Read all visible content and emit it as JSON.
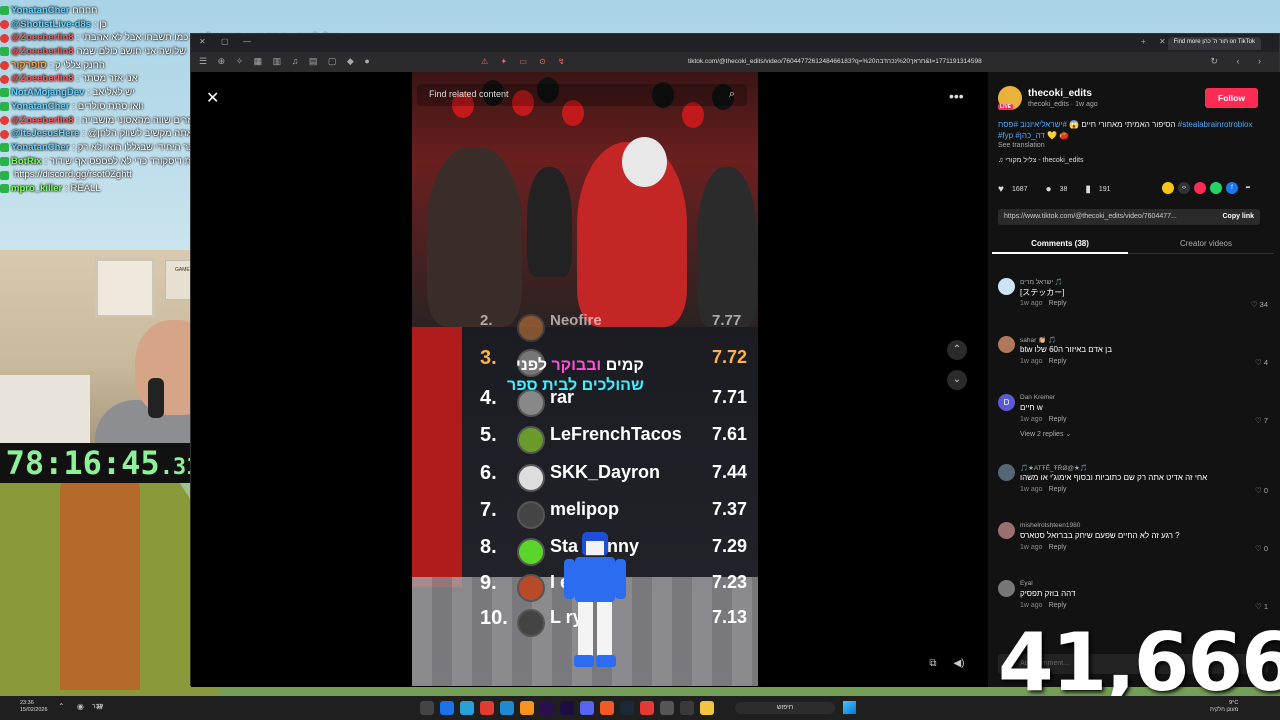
{
  "chat": [
    {
      "user": "YonatanCher",
      "msg": "חחחח",
      "color": "#6ad3ff",
      "badge": "g"
    },
    {
      "user": "@ShotistLive-d8s",
      "msg": ": כן",
      "color": "#6ad3ff",
      "badge": "r"
    },
    {
      "user": "@Zoeeberlin8",
      "msg": ": איך באלי להגיד את מה שאני חושב על ה... כמו תשבחו אבל לא אהבתי",
      "color": "#ff5a5a",
      "badge": "r"
    },
    {
      "user": "@Zoeeberlin8",
      "msg": "שלושה אני חושב כולם שמה",
      "color": "#ff5a5a",
      "badge": "g"
    },
    {
      "user": "סופרקור",
      "msg": ": החנק צללי ק",
      "color": "#ff9a3c",
      "badge": "r"
    },
    {
      "user": "@Zoeeberlin8",
      "msg": ": אני אזר מסתר",
      "color": "#ff5a5a",
      "badge": "r"
    },
    {
      "user": "NotAMojangDev",
      "msg": ": יש לאליאב",
      "color": "#6ad3ff",
      "badge": "g"
    },
    {
      "user": "YonatanCher",
      "msg": ": וואו סתת סולדים",
      "color": "#6ad3ff",
      "badge": "g"
    },
    {
      "user": "@Zoeeberlin8",
      "msg": ": יש האומרים שווה מהאסוני מושבייה",
      "color": "#ff5a5a",
      "badge": "r"
    },
    {
      "user": "@ItsJesusHere",
      "msg": ": @שוטיסט תגיד שו אתה מקשיב לשווק הלחן?",
      "color": "#6ad3ff",
      "badge": "r"
    },
    {
      "user": "YonatanCher",
      "msg": ": זה הדבר היחידי שבגללו הוא ולא רק",
      "color": "#6ad3ff",
      "badge": "g"
    },
    {
      "user": "BotRix",
      "msg": ": אם אתם נהנים מהשידורים כנסו לשרת דיסקורד כדי לא לפספס אף שידור",
      "color": "#7cff5a",
      "badge": "g"
    },
    {
      "user": "",
      "msg": "https://discord.gg/rsot0Zghtt",
      "color": "#ffffff",
      "badge": "g"
    },
    {
      "user": "mpro_killer",
      "msg": ": REALL",
      "color": "#7cff5a",
      "badge": "g"
    }
  ],
  "webcam": {
    "poster_text": "GAME ZONE"
  },
  "timer": {
    "main": "78:16:45",
    "fraction": ".31"
  },
  "browser": {
    "url": "tiktok.com/@thecoki_edits/video/7604477261248466183?q=%20חראך%20נכהדבה&t=1771191314598",
    "tab_title": "Find more תור ה' כהן on TikTok",
    "tab_close": "✕",
    "new_tab": "+",
    "extension_icons": "⚠ ✦ ▭ ⊙ ↯",
    "toolbar_left": "☰ ⊕ ✧ ▦ ▥ ♫ ▤ ▢ ◆ ●",
    "nav_icons": "↻ ‹ ›"
  },
  "video": {
    "search_placeholder": "Find related content",
    "caption_line1_white": "קמים ",
    "caption_line1_pink": "ובבוקר",
    "caption_line1_white2": " לפני",
    "caption_line2": "שהולכים לבית ספר",
    "leaderboard": [
      {
        "rank": "2.",
        "name": "Neofire",
        "score": "7.77"
      },
      {
        "rank": "3.",
        "name": "",
        "score": "7.72"
      },
      {
        "rank": "4.",
        "name": "rar",
        "score": "7.71"
      },
      {
        "rank": "5.",
        "name": "LeFrenchTacos",
        "score": "7.61"
      },
      {
        "rank": "6.",
        "name": "SKK_Dayron",
        "score": "7.44"
      },
      {
        "rank": "7.",
        "name": "melipop",
        "score": "7.37"
      },
      {
        "rank": "8.",
        "name": "Sta     Bunny",
        "score": "7.29"
      },
      {
        "rank": "9.",
        "name": "I        et",
        "score": "7.23"
      },
      {
        "rank": "10.",
        "name": "L        ry",
        "score": "7.13"
      }
    ]
  },
  "controls": {
    "close": "✕",
    "more": "•••",
    "up": "⌃",
    "down": "⌄"
  },
  "panel": {
    "author": "thecoki_edits",
    "author_meta": "thecoki_edits · 1w ago",
    "live_label": "LIVE",
    "follow": "Follow",
    "description_pre": "הסיפור האמיתי מאחורי חיים 😱 ",
    "description_tags": "#ישראליאיונוב #פסח #stealabrainrotroblox #fyp #דה_כהן",
    "description_post": "💛 🍅",
    "see_translation": "See translation",
    "music": "♫ צליל מקורי - thecoki_edits",
    "likes": "1687",
    "comments_count": "38",
    "saves": "191",
    "share_url": "https://www.tiktok.com/@thecoki_edits/video/7604477...",
    "copy_link": "Copy link",
    "tab_comments": "Comments (38)",
    "tab_creator": "Creator videos",
    "comments": [
      {
        "user": "ישראל מרים 🎵",
        "text": "[ステッカー]",
        "time": "1w ago",
        "likes": "♡ 34",
        "avatar_color": "#cfe3f7",
        "initial": ""
      },
      {
        "user": "sahar 👏🏼 🎵",
        "text": "btw בן אדם באיזור ה60 שלו",
        "time": "1w ago",
        "likes": "♡ 4",
        "avatar_color": "#b0785a",
        "initial": ""
      },
      {
        "user": "Dan Kremer",
        "text": "חיים w",
        "time": "1w ago",
        "likes": "♡ 7",
        "avatar_color": "#5a5ad6",
        "initial": "D"
      },
      {
        "user": "🎵★ATŦĚ_ŦŔØ@★🎵",
        "text": "אחי זה אדיט אתה רק שם כתוביות ובסוף אימוג'י או משהו",
        "time": "1w ago",
        "likes": "♡ 0",
        "avatar_color": "#556677",
        "initial": ""
      },
      {
        "user": "mishelrotshteen1980",
        "text": "רגע זה לא החיים שפעם שיחק בברזאל סטארס ?",
        "time": "1w ago",
        "likes": "♡ 0",
        "avatar_color": "#9a6f6f",
        "initial": ""
      },
      {
        "user": "Eyal",
        "text": "דהה בוזק תפסיק",
        "time": "1w ago",
        "likes": "♡ 1",
        "avatar_color": "#777777",
        "initial": ""
      }
    ],
    "reply_label": "Reply",
    "view_replies": "View 2 replies ⌄",
    "comment_placeholder": "Add comment..."
  },
  "counter": "41,666",
  "taskbar": {
    "time": "23:36",
    "date": "15/02/2026",
    "lang": "עבר",
    "search": "חיפוש",
    "weather": "9°C",
    "weather_desc": "מעונן חלקית",
    "sys_icons": "⌃ ◉ ⊟",
    "start_icon": "windows-logo"
  }
}
